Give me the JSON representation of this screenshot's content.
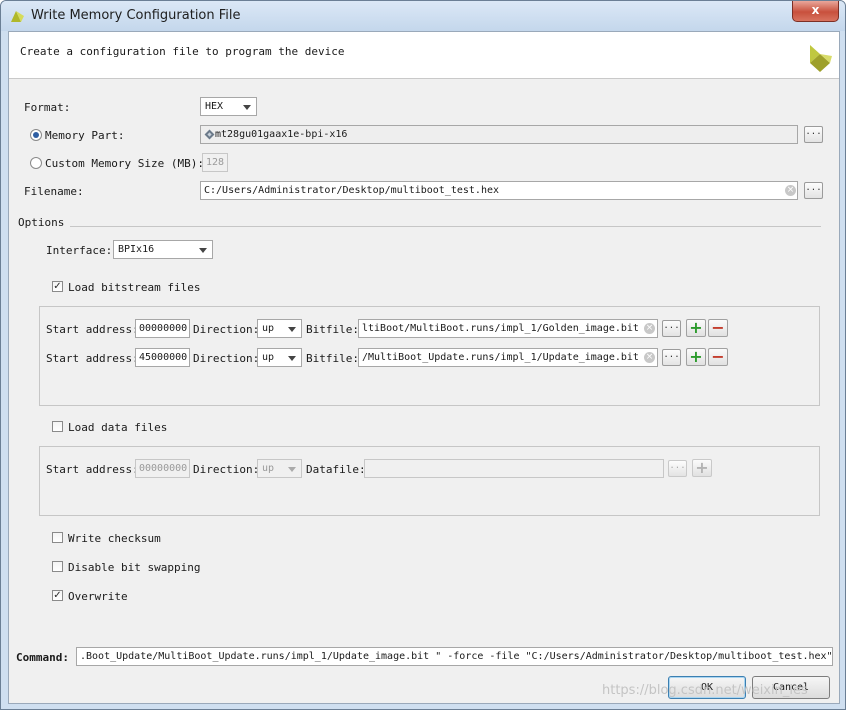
{
  "window": {
    "title": "Write Memory Configuration File",
    "close_glyph": "x"
  },
  "header": {
    "description": "Create a configuration file to program the device"
  },
  "format": {
    "label": "Format:",
    "value": "HEX"
  },
  "memory_part": {
    "label": "Memory Part:",
    "value": "mt28gu01gaax1e-bpi-x16",
    "browse": "..."
  },
  "custom_memory": {
    "label": "Custom Memory Size (MB):",
    "value": "128"
  },
  "filename": {
    "label": "Filename:",
    "value": "C:/Users/Administrator/Desktop/multiboot_test.hex",
    "browse": "..."
  },
  "options": {
    "label": "Options"
  },
  "interface": {
    "label": "Interface:",
    "value": "BPIx16"
  },
  "load_bitstream": {
    "label": "Load bitstream files",
    "checked": true
  },
  "bitstream_rows": [
    {
      "start_label": "Start address:",
      "address": "00000000",
      "direction_label": "Direction:",
      "direction": "up",
      "file_label": "Bitfile:",
      "file": "ltiBoot/MultiBoot.runs/impl_1/Golden_image.bit",
      "browse": "..."
    },
    {
      "start_label": "Start address:",
      "address": "45000000",
      "direction_label": "Direction:",
      "direction": "up",
      "file_label": "Bitfile:",
      "file": "/MultiBoot_Update.runs/impl_1/Update_image.bit",
      "browse": "..."
    }
  ],
  "load_data": {
    "label": "Load data files",
    "checked": false
  },
  "data_row": {
    "start_label": "Start address:",
    "address": "00000000",
    "direction_label": "Direction:",
    "direction": "up",
    "file_label": "Datafile:",
    "file": "",
    "browse": "..."
  },
  "write_checksum": {
    "label": "Write checksum",
    "checked": false
  },
  "disable_bit_swapping": {
    "label": "Disable bit swapping",
    "checked": false
  },
  "overwrite": {
    "label": "Overwrite",
    "checked": true
  },
  "command": {
    "label": "Command:",
    "value": ".Boot_Update/MultiBoot_Update.runs/impl_1/Update_image.bit \" -force -file \"C:/Users/Administrator/Desktop/multiboot_test.hex\""
  },
  "buttons": {
    "ok": "OK",
    "cancel": "Cancel"
  },
  "watermark": "https://blog.csdn.net/weixin_les",
  "colors": {
    "accent_plus": "#2b9b2b",
    "accent_minus": "#c33a2a",
    "titlebar": "#cfdff0",
    "close": "#c8503d"
  }
}
